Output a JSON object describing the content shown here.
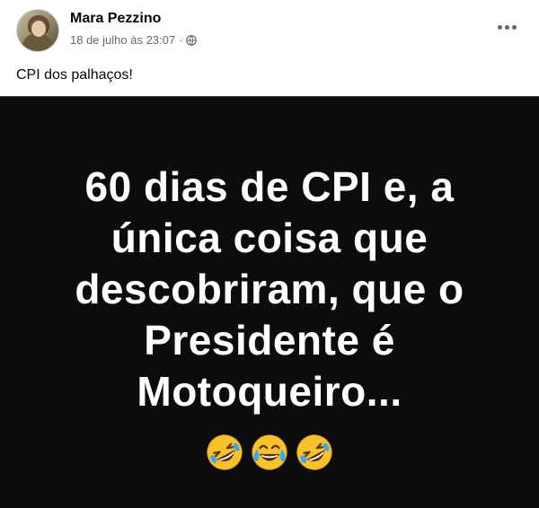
{
  "post": {
    "author": "Mara Pezzino",
    "timestamp": "18 de julho às 23:07",
    "separator": "·",
    "privacy_icon": "globe-icon",
    "more_icon": "more-horizontal-icon",
    "caption": "CPI dos palhaços!"
  },
  "media": {
    "background_color": "#0c0c0c",
    "text_color": "#ffffff",
    "lines": [
      "60 dias de CPI e, a",
      "única coisa que",
      "descobriram, que o",
      "Presidente é",
      "Motoqueiro..."
    ],
    "emojis": [
      "rolling-on-floor-laughing-emoji",
      "face-with-tears-of-joy-emoji",
      "rolling-on-floor-laughing-emoji"
    ]
  }
}
